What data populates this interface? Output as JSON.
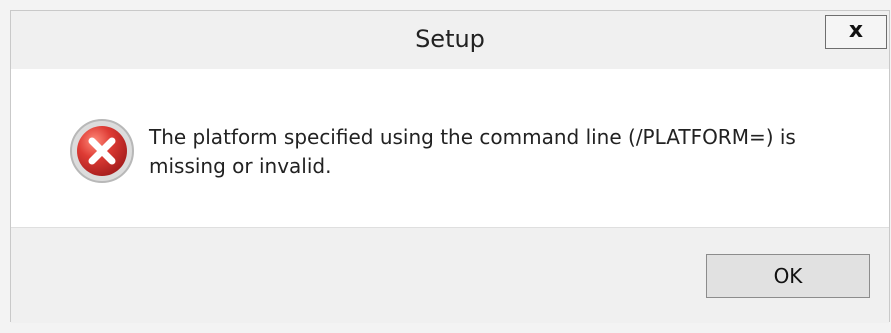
{
  "window": {
    "title": "Setup",
    "close_label": "x"
  },
  "dialog": {
    "icon": "error-icon",
    "message": "The platform specified using the command line (/PLATFORM=) is missing or invalid.",
    "ok_label": "OK"
  },
  "colors": {
    "icon_red": "#d63b3b",
    "background": "#f0f0f0",
    "content_background": "#ffffff"
  }
}
